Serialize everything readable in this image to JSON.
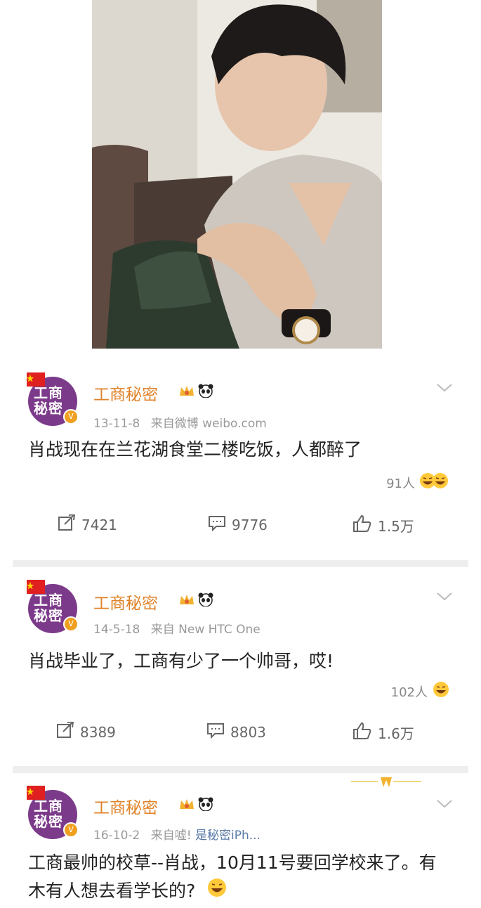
{
  "posts": [
    {
      "avatar_text": "工商秘密",
      "name": "工商秘密",
      "date": "13-11-8",
      "source": "来自微博 weibo.com",
      "content": "肖战现在在兰花湖食堂二楼吃饭，人都醉了",
      "reaction_count": "91人",
      "repost": "7421",
      "comment": "9776",
      "like": "1.5万"
    },
    {
      "avatar_text": "工商秘密",
      "name": "工商秘密",
      "date": "14-5-18",
      "source": "来自 New HTC One",
      "content": "肖战毕业了，工商有少了一个帅哥，哎!",
      "reaction_count": "102人",
      "repost": "8389",
      "comment": "8803",
      "like": "1.6万"
    },
    {
      "avatar_text": "工商秘密",
      "name": "工商秘密",
      "date": "16-10-2",
      "source": "来自嘘!",
      "source_link": "是秘密iPh...",
      "content": "工商最帅的校草--肖战，10月11号要回学校来了。有木有人想去看学长的?"
    }
  ],
  "icons": {
    "repost": "repost-icon",
    "comment": "comment-icon",
    "like": "thumbs-up-icon",
    "more": "chevron-down-icon",
    "crown": "crown-badge-icon",
    "panda": "panda-badge-icon",
    "reaction": "laughing-emoji-icon"
  },
  "colors": {
    "name": "#e0832a",
    "meta": "#999999",
    "separator": "#eeeeee",
    "avatar": "#7c3a8a",
    "link": "#5a7ba8"
  }
}
